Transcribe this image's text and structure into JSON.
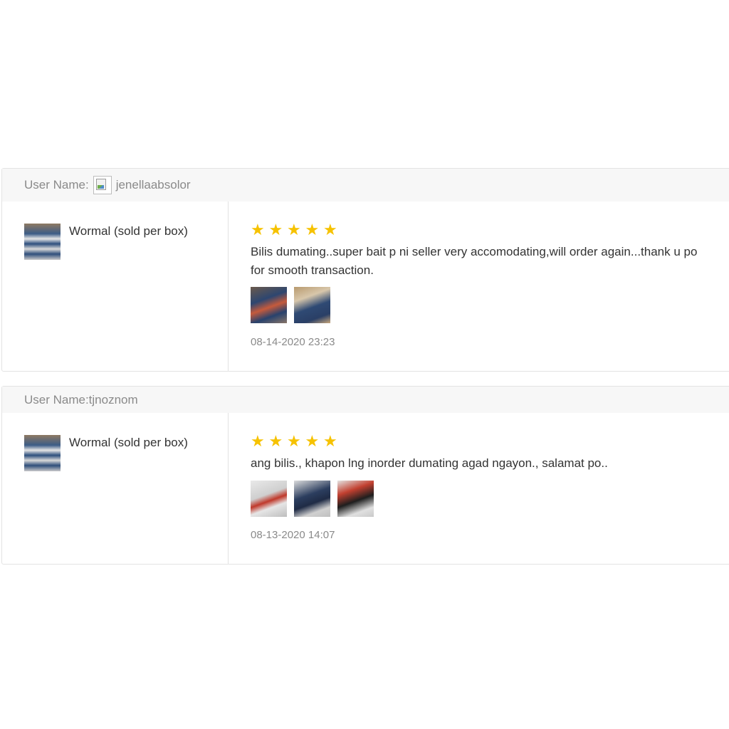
{
  "reviews": [
    {
      "user_label": "User Name:",
      "username": "jenellaabsolor",
      "product_name": "Wormal (sold per box)",
      "rating": 5,
      "text": "Bilis dumating..super bait p ni seller very accomodating,will order again...thank u po for smooth transaction.",
      "photo_count": 2,
      "date": "08-14-2020 23:23"
    },
    {
      "user_label": "User Name:tjnoznom",
      "product_name": "Wormal (sold per box)",
      "rating": 5,
      "text": "ang bilis., khapon lng inorder dumating agad ngayon., salamat po..",
      "photo_count": 3,
      "date": "08-13-2020 14:07"
    }
  ],
  "icons": {
    "star": "star-icon",
    "avatar": "broken-image-icon"
  },
  "colors": {
    "star": "#f6c200",
    "text": "#333333",
    "muted": "#8a8a8a",
    "header_bg": "#f7f7f7",
    "border": "#e3e3e3"
  }
}
